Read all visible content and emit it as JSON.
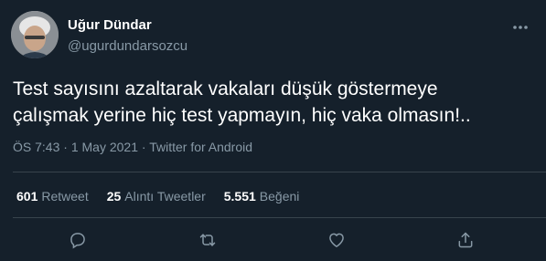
{
  "user": {
    "name": "Uğur Dündar",
    "handle": "@ugurdundarsozcu"
  },
  "tweet": {
    "text": "Test sayısını azaltarak vakaları düşük göstermeye\nçalışmak yerine hiç test yapmayın, hiç vaka olmasın!.."
  },
  "meta": {
    "time": "ÖS 7:43",
    "separator": " · ",
    "date": "1 May 2021",
    "source": "Twitter for Android"
  },
  "stats": {
    "retweets_count": "601",
    "retweets_label": "Retweet",
    "quotes_count": "25",
    "quotes_label": "Alıntı Tweetler",
    "likes_count": "5.551",
    "likes_label": "Beğeni"
  },
  "icons": {
    "more": "more-icon",
    "reply": "reply-icon",
    "retweet": "retweet-icon",
    "like": "heart-icon",
    "share": "share-icon"
  },
  "colors": {
    "background": "#15202b",
    "secondary_text": "#8899a6",
    "divider": "#38444d"
  }
}
